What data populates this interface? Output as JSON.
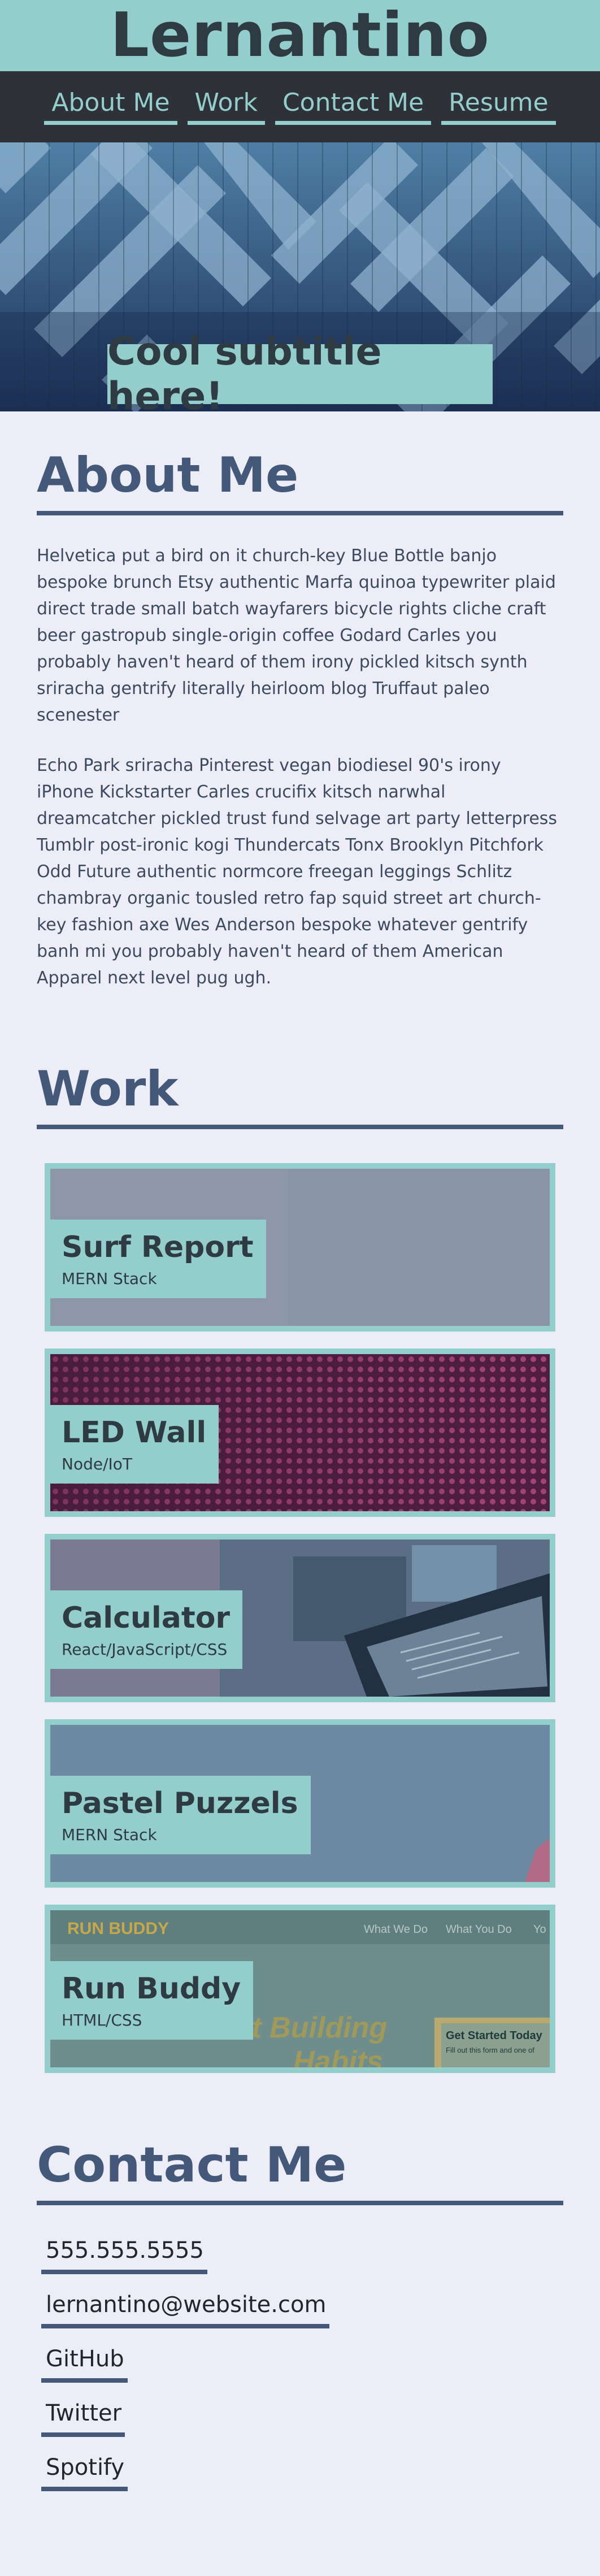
{
  "site": {
    "title": "Lernantino"
  },
  "nav": {
    "items": [
      {
        "label": "About Me"
      },
      {
        "label": "Work"
      },
      {
        "label": "Contact Me"
      },
      {
        "label": "Resume"
      }
    ]
  },
  "hero": {
    "subtitle": "Cool subtitle here!"
  },
  "about": {
    "title": "About Me",
    "paragraphs": [
      "Helvetica put a bird on it church-key Blue Bottle banjo bespoke brunch Etsy authentic Marfa quinoa typewriter plaid direct trade small batch wayfarers bicycle rights cliche craft beer gastropub single-origin coffee Godard Carles you probably haven't heard of them irony pickled kitsch synth sriracha gentrify literally heirloom blog Truffaut paleo scenester",
      "Echo Park sriracha Pinterest vegan biodiesel 90's irony iPhone Kickstarter Carles crucifix kitsch narwhal dreamcatcher pickled trust fund selvage art party letterpress Tumblr post-ironic kogi Thundercats Tonx Brooklyn Pitchfork Odd Future authentic normcore freegan leggings Schlitz chambray organic tousled retro fap squid street art church-key fashion axe Wes Anderson bespoke whatever gentrify banh mi you probably haven't heard of them American Apparel next level pug ugh."
    ]
  },
  "work": {
    "title": "Work",
    "projects": [
      {
        "name": "Surf Report",
        "stack": "MERN Stack"
      },
      {
        "name": "LED Wall",
        "stack": "Node/IoT"
      },
      {
        "name": "Calculator",
        "stack": "React/JavaScript/CSS"
      },
      {
        "name": "Pastel Puzzels",
        "stack": "MERN Stack"
      },
      {
        "name": "Run Buddy",
        "stack": "HTML/CSS",
        "screenshot": {
          "logo": "RUN BUDDY",
          "nav": [
            "What We Do",
            "What You Do",
            "Yo"
          ],
          "headline": "tart Building",
          "headline2": "Habits",
          "cta_title": "Get Started Today",
          "cta_text": "Fill out this form and one of"
        }
      }
    ]
  },
  "contact": {
    "title": "Contact Me",
    "items": [
      {
        "label": "555.555.5555"
      },
      {
        "label": "lernantino@website.com"
      },
      {
        "label": "GitHub"
      },
      {
        "label": "Twitter"
      },
      {
        "label": "Spotify"
      }
    ]
  },
  "colors": {
    "header_bg": "#93CDCC",
    "nav_bg": "#2F3139",
    "page_bg": "#ECEDF7",
    "heading": "#44587A",
    "accent": "#93CDCC"
  }
}
